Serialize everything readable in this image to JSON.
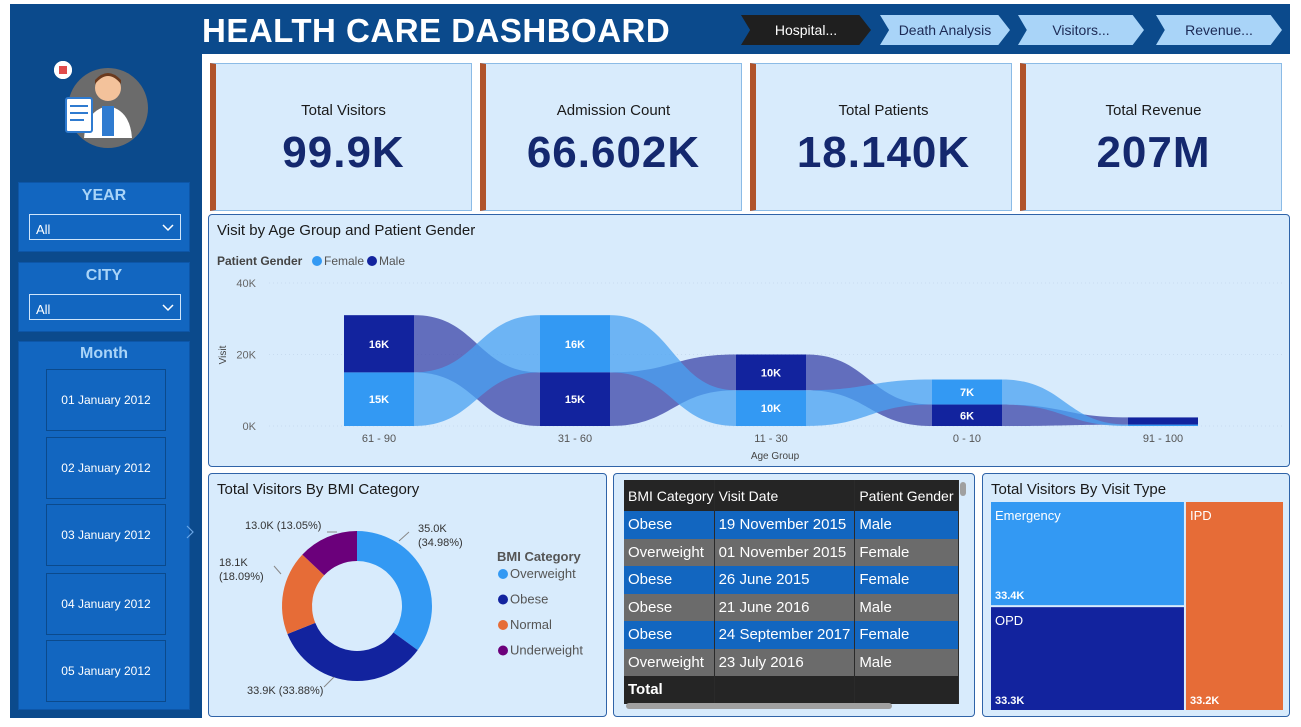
{
  "header": {
    "title": "HEALTH CARE DASHBOARD",
    "nav": [
      "Hospital...",
      "Death Analysis",
      "Visitors...",
      "Revenue..."
    ]
  },
  "filters": {
    "year": {
      "title": "YEAR",
      "value": "All"
    },
    "city": {
      "title": "CITY",
      "value": "All"
    },
    "month": {
      "title": "Month",
      "items": [
        "01 January 2012",
        "02 January 2012",
        "03 January 2012",
        "04 January 2012",
        "05 January 2012"
      ]
    }
  },
  "kpis": [
    {
      "label": "Total Visitors",
      "value": "99.9K"
    },
    {
      "label": "Admission Count",
      "value": "66.602K"
    },
    {
      "label": "Total Patients",
      "value": "18.140K"
    },
    {
      "label": "Total Revenue",
      "value": "207M"
    }
  ],
  "colors": {
    "female": "#3399f3",
    "male": "#12239e",
    "orange": "#e66c37",
    "purple": "#6b007b",
    "accent": "#b0532b"
  },
  "chart_data": [
    {
      "type": "ribbon",
      "title": "Visit by Age Group and Patient Gender",
      "legend_title": "Patient Gender",
      "xlabel": "Age Group",
      "ylabel": "Visit",
      "yticks": [
        "40K",
        "20K",
        "0K"
      ],
      "ylim": [
        0,
        40000
      ],
      "categories": [
        "61 - 90",
        "31 - 60",
        "11 - 30",
        "0 - 10",
        "91 - 100"
      ],
      "series": [
        {
          "name": "Female",
          "values": [
            15000,
            16000,
            10000,
            7000,
            400
          ],
          "labels": [
            "15K",
            "16K",
            "10K",
            "7K",
            ""
          ]
        },
        {
          "name": "Male",
          "values": [
            16000,
            15000,
            10000,
            6000,
            2000
          ],
          "labels": [
            "16K",
            "15K",
            "10K",
            "6K",
            ""
          ]
        }
      ]
    },
    {
      "type": "pie",
      "title": "Total Visitors By BMI Category",
      "legend_title": "BMI Category",
      "slices": [
        {
          "name": "Overweight",
          "value": 35000,
          "pct": 34.98,
          "label1": "35.0K",
          "label2": "(34.98%)"
        },
        {
          "name": "Obese",
          "value": 33900,
          "pct": 33.88,
          "label1": "33.9K (33.88%)",
          "label2": ""
        },
        {
          "name": "Normal",
          "value": 18100,
          "pct": 18.09,
          "label1": "18.1K",
          "label2": "(18.09%)"
        },
        {
          "name": "Underweight",
          "value": 13000,
          "pct": 13.05,
          "label1": "13.0K (13.05%)",
          "label2": ""
        }
      ]
    },
    {
      "type": "treemap",
      "title": "Total Visitors By Visit Type",
      "items": [
        {
          "name": "Emergency",
          "value": 33400,
          "label": "33.4K"
        },
        {
          "name": "OPD",
          "value": 33300,
          "label": "33.3K"
        },
        {
          "name": "IPD",
          "value": 33200,
          "label": "33.2K"
        }
      ]
    }
  ],
  "table": {
    "headers": [
      "BMI Category",
      "Visit Date",
      "Patient Gender"
    ],
    "rows": [
      [
        "Obese",
        "19 November 2015",
        "Male"
      ],
      [
        "Overweight",
        "01 November 2015",
        "Female"
      ],
      [
        "Obese",
        "26 June 2015",
        "Female"
      ],
      [
        "Obese",
        "21 June 2016",
        "Male"
      ],
      [
        "Obese",
        "24 September 2017",
        "Female"
      ],
      [
        "Overweight",
        "23 July 2016",
        "Male"
      ]
    ],
    "total_label": "Total"
  }
}
